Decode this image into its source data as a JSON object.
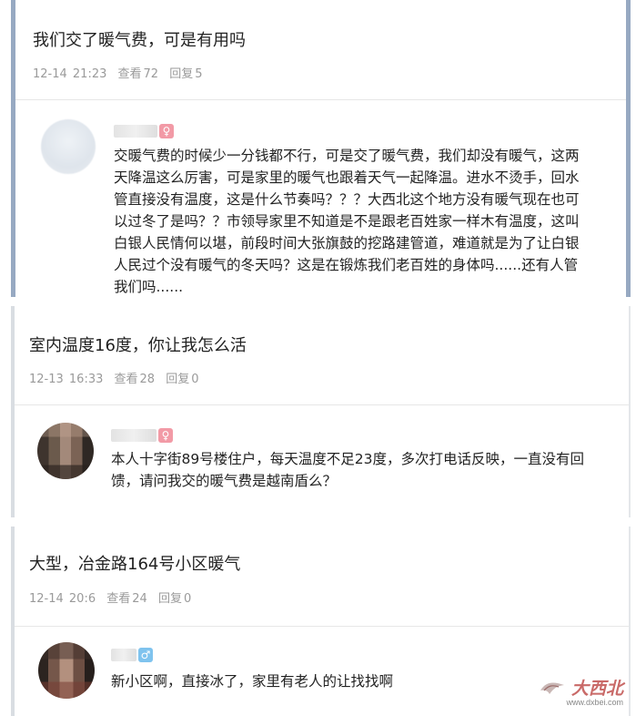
{
  "posts": [
    {
      "title": "我们交了暖气费，可是有用吗",
      "time": "12-14 21:23",
      "views_label": "查看",
      "views": "72",
      "replies_label": "回复",
      "replies": "5",
      "reply": {
        "gender": "female",
        "gender_icon": "♀",
        "text": "交暖气费的时候少一分钱都不行，可是交了暖气费，我们却没有暖气，这两天降温这么厉害，可是家里的暖气也跟着天气一起降温。进水不烫手，回水管直接没有温度，这是什么节奏吗？？？大西北这个地方没有暖气现在也可以过冬了是吗？？市领导家里不知道是不是跟老百姓家一样木有温度，这叫白银人民情何以堪，前段时间大张旗鼓的挖路建管道，难道就是为了让白银人民过个没有暖气的冬天吗？这是在锻炼我们老百姓的身体吗......还有人管我们吗......"
      }
    },
    {
      "title": "室内温度16度，你让我怎么活",
      "time": "12-13 16:33",
      "views_label": "查看",
      "views": "28",
      "replies_label": "回复",
      "replies": "0",
      "reply": {
        "gender": "female",
        "gender_icon": "♀",
        "text": "本人十字街89号楼住户，每天温度不足23度，多次打电话反映，一直没有回馈，请问我交的暖气费是越南盾么？"
      }
    },
    {
      "title": "大型，冶金路164号小区暖气",
      "time": "12-14 20:6",
      "views_label": "查看",
      "views": "24",
      "replies_label": "回复",
      "replies": "0",
      "reply": {
        "gender": "male",
        "gender_icon": "♂",
        "text": "新小区啊，直接冰了，家里有老人的让找找啊"
      }
    }
  ],
  "watermark": {
    "logo_text": "大西北",
    "url": "www.dxbei.com"
  },
  "colors": {
    "female": "#f29aa6",
    "male": "#7fc3ee",
    "accent_border": "#97a9c2"
  }
}
